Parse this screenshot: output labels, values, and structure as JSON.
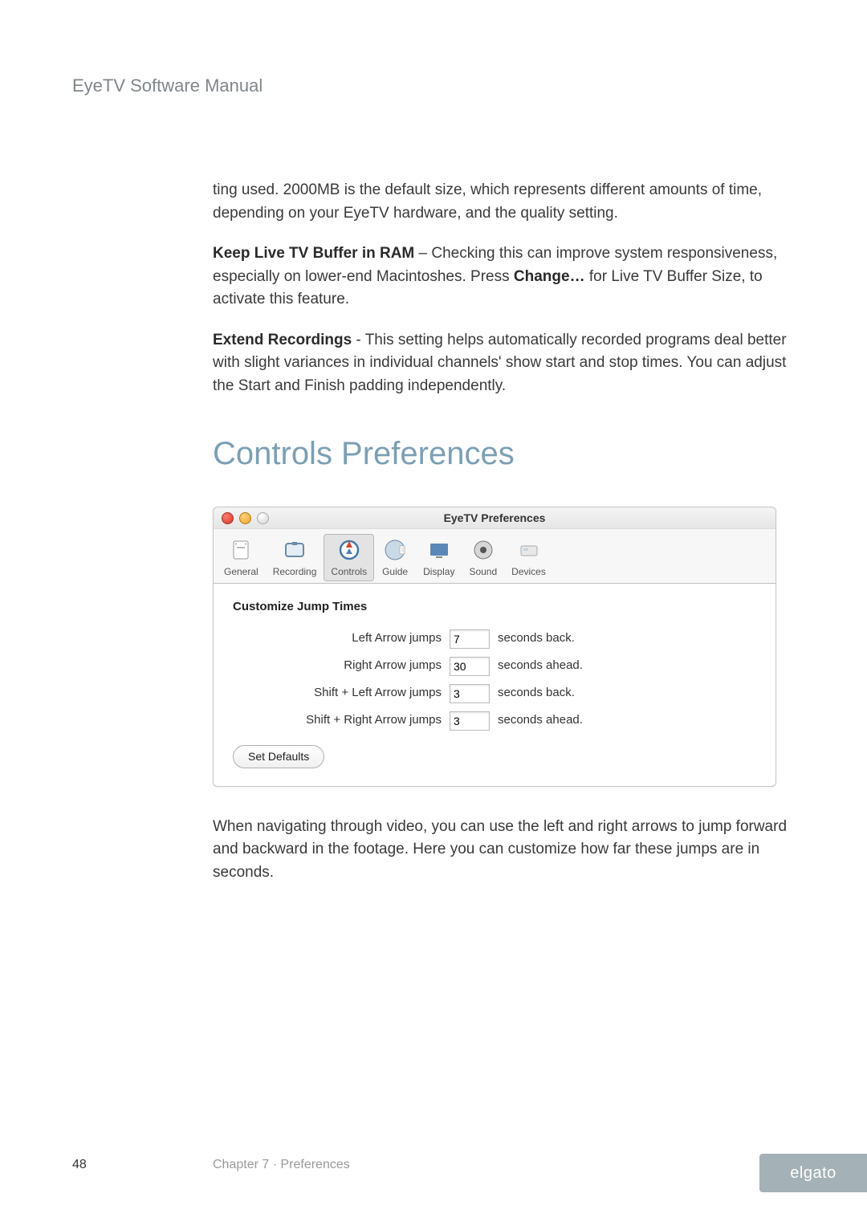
{
  "header": {
    "title": "EyeTV Software Manual"
  },
  "body": {
    "p1": "ting used.  2000MB is the default size, which represents different amounts of time, depending on your EyeTV hardware, and the quality setting.",
    "p2_bold": "Keep Live TV Buffer in RAM",
    "p2a": " – Checking this can improve system responsiveness, especially on lower-end Macintoshes.  Press ",
    "p2_bold2": "Change…",
    "p2b": " for Live TV Buffer Size, to activate this feature.",
    "p3_bold": "Extend Recordings",
    "p3a": " - This setting helps automatically recorded programs deal better with slight variances in individual channels' show start and stop times.  You can adjust the Start and Finish padding independently.",
    "section_title": "Controls Preferences",
    "after_win": "When navigating through video, you can use the left and right arrows to jump forward and backward in the footage. Here you can customize how far these jumps are in seconds."
  },
  "prefwin": {
    "title": "EyeTV Preferences",
    "tabs": [
      {
        "label": "General",
        "icon": "general-icon"
      },
      {
        "label": "Recording",
        "icon": "recording-icon"
      },
      {
        "label": "Controls",
        "icon": "controls-icon"
      },
      {
        "label": "Guide",
        "icon": "guide-icon"
      },
      {
        "label": "Display",
        "icon": "display-icon"
      },
      {
        "label": "Sound",
        "icon": "sound-icon"
      },
      {
        "label": "Devices",
        "icon": "devices-icon"
      }
    ],
    "selected_tab": "Controls",
    "pane": {
      "heading": "Customize Jump Times",
      "rows": [
        {
          "label": "Left Arrow jumps",
          "value": "7",
          "after": "seconds back."
        },
        {
          "label": "Right Arrow jumps",
          "value": "30",
          "after": "seconds ahead."
        },
        {
          "label": "Shift + Left Arrow jumps",
          "value": "3",
          "after": "seconds back."
        },
        {
          "label": "Shift + Right Arrow jumps",
          "value": "3",
          "after": "seconds ahead."
        }
      ],
      "button": "Set Defaults"
    }
  },
  "footer": {
    "page": "48",
    "chapter": "Chapter 7 · Preferences",
    "brand": "elgato"
  }
}
